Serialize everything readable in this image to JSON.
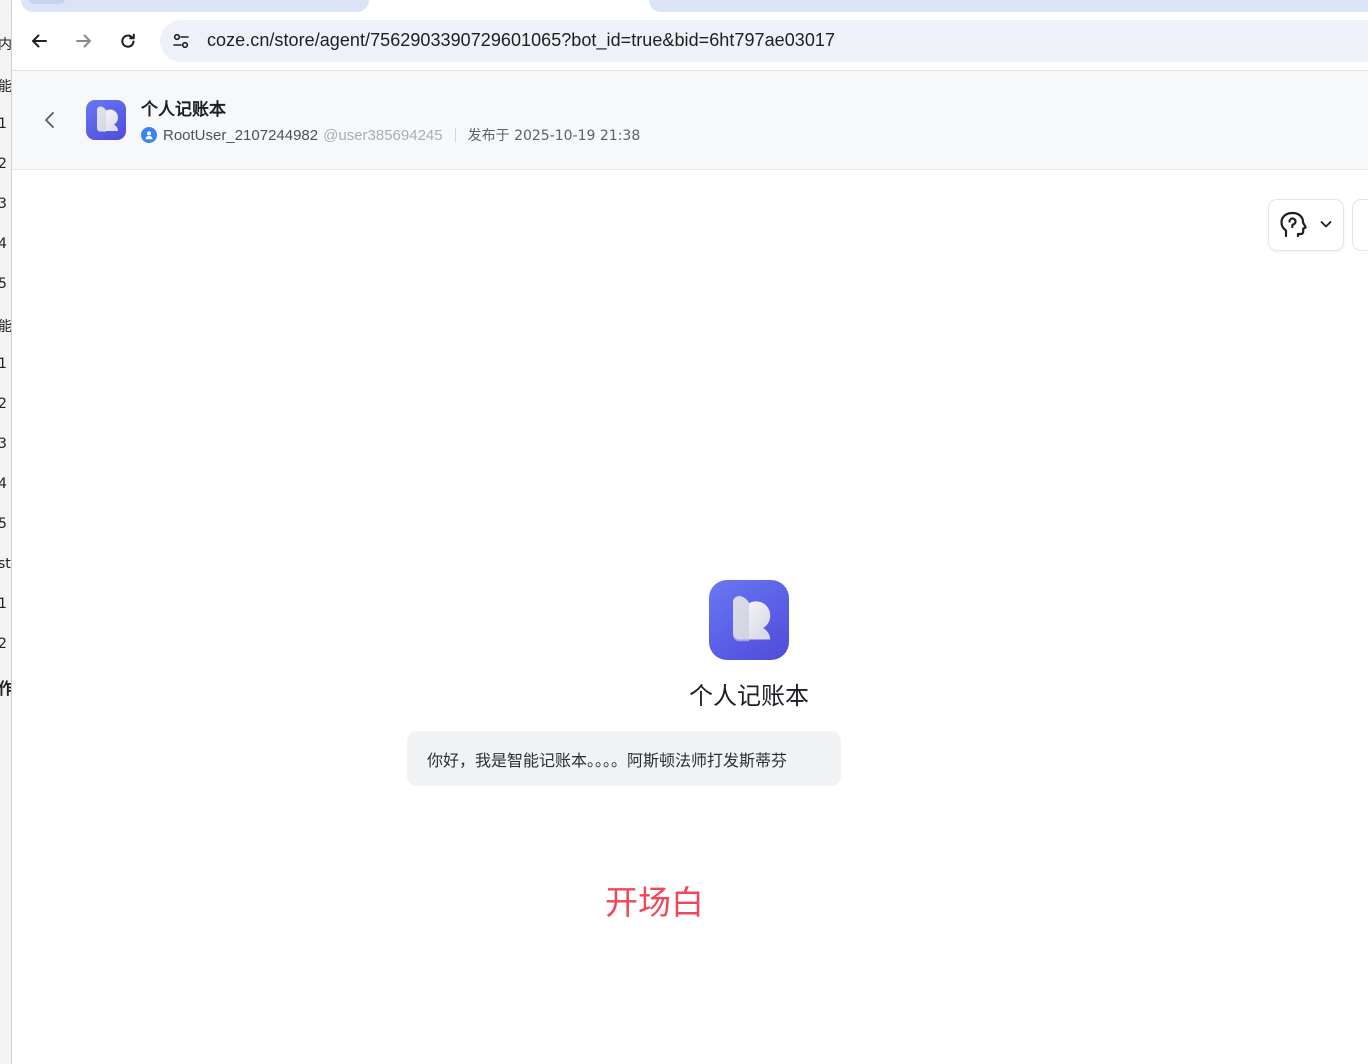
{
  "background_window": {
    "fragments": [
      "内",
      "能",
      "1",
      "2",
      "3",
      "4",
      "5",
      "能",
      "1",
      "2",
      "3",
      "4",
      "5",
      "st",
      "1",
      "2",
      "作"
    ]
  },
  "browser": {
    "url": "coze.cn/store/agent/7562903390729601065?bot_id=true&bid=6ht797ae03017"
  },
  "header": {
    "title": "个人记账本",
    "author_name": "RootUser_2107244982",
    "author_handle": "@user385694245",
    "publish_time": "发布于 2025-10-19 21:38"
  },
  "bot": {
    "name": "个人记账本",
    "greeting": "你好，我是智能记账本。。。。阿斯顿法师打发斯蒂芬"
  },
  "annotation": {
    "label": "开场白",
    "color": "#f0475a"
  },
  "colors": {
    "brand_icon": "#5a5fe6",
    "author_avatar": "#3b82f6",
    "address_bar": "#eef1f8"
  }
}
